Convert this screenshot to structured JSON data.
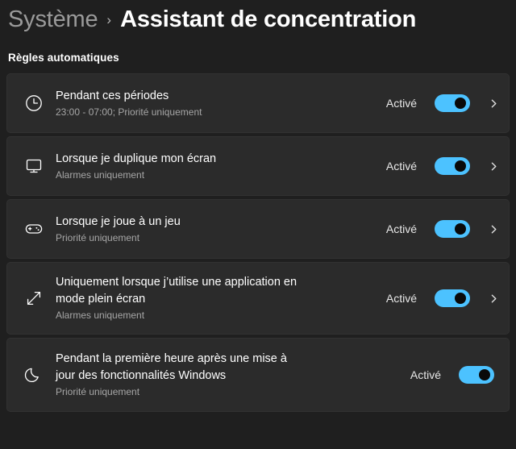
{
  "header": {
    "parent": "Système",
    "separator": "›",
    "title": "Assistant de concentration"
  },
  "section": {
    "title": "Règles automatiques"
  },
  "colors": {
    "page_background": "#1f1f1f",
    "card_background": "#2b2b2b",
    "toggle_on": "#4cc2ff",
    "toggle_knob": "#0a0a0a",
    "text_primary": "#ffffff",
    "text_secondary": "#a6a6a6",
    "breadcrumb_parent": "#9a9a9a"
  },
  "rules": [
    {
      "icon": "clock-icon",
      "title": "Pendant ces périodes",
      "subtitle": "23:00 - 07:00; Priorité uniquement",
      "state": "Activé",
      "toggle": "on",
      "chevron": "›"
    },
    {
      "icon": "monitor-icon",
      "title": "Lorsque je duplique mon écran",
      "subtitle": "Alarmes uniquement",
      "state": "Activé",
      "toggle": "on",
      "chevron": "›"
    },
    {
      "icon": "gamepad-icon",
      "title": "Lorsque je joue à un jeu",
      "subtitle": "Priorité uniquement",
      "state": "Activé",
      "toggle": "on",
      "chevron": "›"
    },
    {
      "icon": "fullscreen-icon",
      "title": "Uniquement lorsque j’utilise une application en mode plein écran",
      "subtitle": "Alarmes uniquement",
      "state": "Activé",
      "toggle": "on",
      "chevron": "›"
    },
    {
      "icon": "moon-icon",
      "title": "Pendant la première heure après une mise à jour des fonctionnalités Windows",
      "subtitle": "Priorité uniquement",
      "state": "Activé",
      "toggle": "on",
      "chevron": ""
    }
  ]
}
